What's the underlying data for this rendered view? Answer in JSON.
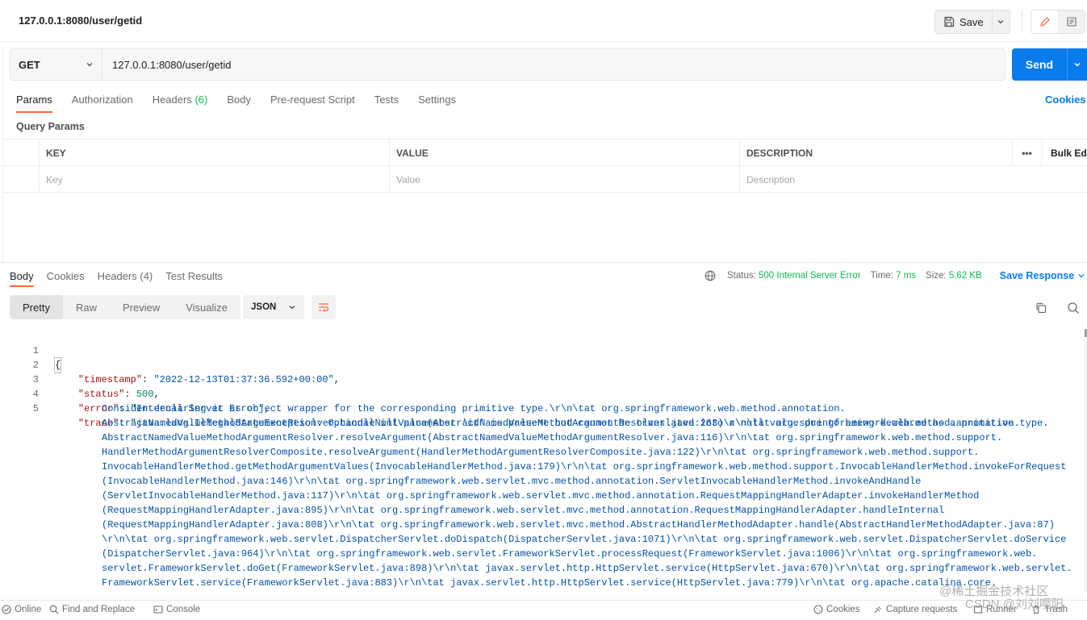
{
  "title_bar": {
    "title": "127.0.0.1:8080/user/getid",
    "save_label": "Save"
  },
  "request": {
    "method": "GET",
    "url": "127.0.0.1:8080/user/getid",
    "send_label": "Send"
  },
  "request_tabs": [
    {
      "label": "Params",
      "active": true
    },
    {
      "label": "Authorization"
    },
    {
      "label": "Headers",
      "count": "(6)"
    },
    {
      "label": "Body"
    },
    {
      "label": "Pre-request Script"
    },
    {
      "label": "Tests"
    },
    {
      "label": "Settings"
    }
  ],
  "cookies_link": "Cookies",
  "query_params": {
    "title": "Query Params",
    "headers": {
      "key": "KEY",
      "value": "VALUE",
      "description": "DESCRIPTION",
      "more": "•••",
      "bulk_edit": "Bulk Edit"
    },
    "placeholders": {
      "key": "Key",
      "value": "Value",
      "description": "Description"
    }
  },
  "response_tabs": [
    {
      "label": "Body",
      "active": true
    },
    {
      "label": "Cookies"
    },
    {
      "label": "Headers (4)"
    },
    {
      "label": "Test Results"
    }
  ],
  "response_meta": {
    "status_label": "Status:",
    "status_value": "500 Internal Server Error",
    "time_label": "Time:",
    "time_value": "7 ms",
    "size_label": "Size:",
    "size_value": "5.62 KB",
    "save_response": "Save Response"
  },
  "format_tabs": [
    {
      "label": "Pretty",
      "active": true
    },
    {
      "label": "Raw"
    },
    {
      "label": "Preview"
    },
    {
      "label": "Visualize"
    }
  ],
  "language": "JSON",
  "code": {
    "line_numbers": [
      "1",
      "2",
      "3",
      "4",
      "5"
    ],
    "open_brace": "{",
    "timestamp_key": "\"timestamp\"",
    "timestamp_value": "\"2022-12-13T01:37:36.592+00:00\"",
    "status_key": "\"status\"",
    "status_value": "500",
    "error_key": "\"error\"",
    "error_value": "\"Internal Server Error\"",
    "trace_key": "\"trace\"",
    "trace_lines": [
      "\"java.lang.IllegalStateException: Optional int parameter 'id' is present but cannot be translated into a null value due to being declared as a primitive type.",
      "Consider declaring it as object wrapper for the corresponding primitive type.\\r\\n\\tat org.springframework.web.method.annotation.",
      "AbstractNamedValueMethodArgumentResolver.handleNullValue(AbstractNamedValueMethodArgumentResolver.java:263)\\r\\n\\tat org.springframework.web.method.annotation.",
      "AbstractNamedValueMethodArgumentResolver.resolveArgument(AbstractNamedValueMethodArgumentResolver.java:116)\\r\\n\\tat org.springframework.web.method.support.",
      "HandlerMethodArgumentResolverComposite.resolveArgument(HandlerMethodArgumentResolverComposite.java:122)\\r\\n\\tat org.springframework.web.method.support.",
      "InvocableHandlerMethod.getMethodArgumentValues(InvocableHandlerMethod.java:179)\\r\\n\\tat org.springframework.web.method.support.InvocableHandlerMethod.invokeForRequest",
      "(InvocableHandlerMethod.java:146)\\r\\n\\tat org.springframework.web.servlet.mvc.method.annotation.ServletInvocableHandlerMethod.invokeAndHandle",
      "(ServletInvocableHandlerMethod.java:117)\\r\\n\\tat org.springframework.web.servlet.mvc.method.annotation.RequestMappingHandlerAdapter.invokeHandlerMethod",
      "(RequestMappingHandlerAdapter.java:895)\\r\\n\\tat org.springframework.web.servlet.mvc.method.annotation.RequestMappingHandlerAdapter.handleInternal",
      "(RequestMappingHandlerAdapter.java:808)\\r\\n\\tat org.springframework.web.servlet.mvc.method.AbstractHandlerMethodAdapter.handle(AbstractHandlerMethodAdapter.java:87)",
      "\\r\\n\\tat org.springframework.web.servlet.DispatcherServlet.doDispatch(DispatcherServlet.java:1071)\\r\\n\\tat org.springframework.web.servlet.DispatcherServlet.doService",
      "(DispatcherServlet.java:964)\\r\\n\\tat org.springframework.web.servlet.FrameworkServlet.processRequest(FrameworkServlet.java:1006)\\r\\n\\tat org.springframework.web.",
      "servlet.FrameworkServlet.doGet(FrameworkServlet.java:898)\\r\\n\\tat javax.servlet.http.HttpServlet.service(HttpServlet.java:670)\\r\\n\\tat org.springframework.web.servlet.",
      "FrameworkServlet.service(FrameworkServlet.java:883)\\r\\n\\tat javax.servlet.http.HttpServlet.service(HttpServlet.java:779)\\r\\n\\tat org.apache.catalina.core."
    ]
  },
  "status_bar": {
    "online": "Online",
    "find_replace": "Find and Replace",
    "console": "Console",
    "cookies": "Cookies",
    "capture": "Capture requests",
    "runner": "Runner",
    "trash": "Trash"
  },
  "watermark": {
    "line1": "@稀土掘金技术社区",
    "line2": "CSDN @刘刘嘤阳"
  },
  "colors": {
    "accent_orange": "#ff6c37",
    "send_blue": "#097bed",
    "status_green": "#0cbb52"
  }
}
